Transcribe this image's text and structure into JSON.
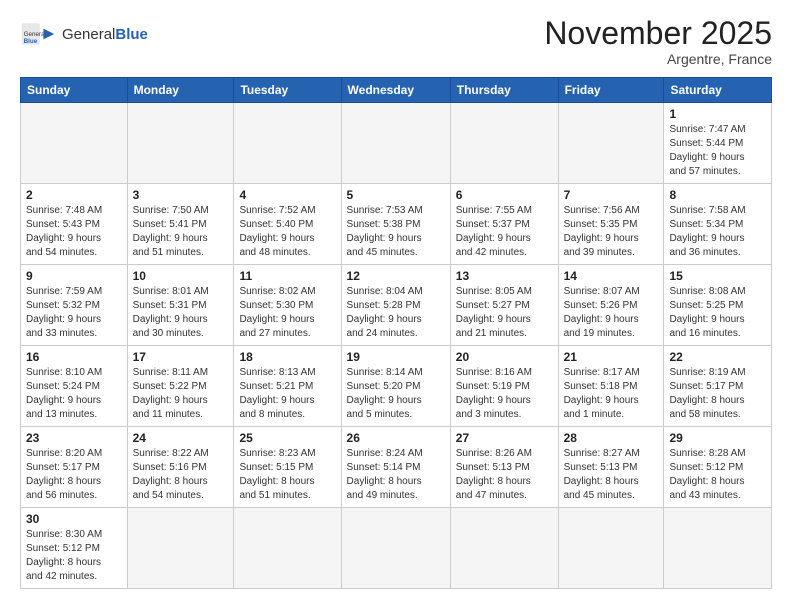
{
  "header": {
    "logo_general": "General",
    "logo_blue": "Blue",
    "month_title": "November 2025",
    "location": "Argentre, France"
  },
  "days_of_week": [
    "Sunday",
    "Monday",
    "Tuesday",
    "Wednesday",
    "Thursday",
    "Friday",
    "Saturday"
  ],
  "weeks": [
    [
      {
        "day": "",
        "info": ""
      },
      {
        "day": "",
        "info": ""
      },
      {
        "day": "",
        "info": ""
      },
      {
        "day": "",
        "info": ""
      },
      {
        "day": "",
        "info": ""
      },
      {
        "day": "",
        "info": ""
      },
      {
        "day": "1",
        "info": "Sunrise: 7:47 AM\nSunset: 5:44 PM\nDaylight: 9 hours\nand 57 minutes."
      }
    ],
    [
      {
        "day": "2",
        "info": "Sunrise: 7:48 AM\nSunset: 5:43 PM\nDaylight: 9 hours\nand 54 minutes."
      },
      {
        "day": "3",
        "info": "Sunrise: 7:50 AM\nSunset: 5:41 PM\nDaylight: 9 hours\nand 51 minutes."
      },
      {
        "day": "4",
        "info": "Sunrise: 7:52 AM\nSunset: 5:40 PM\nDaylight: 9 hours\nand 48 minutes."
      },
      {
        "day": "5",
        "info": "Sunrise: 7:53 AM\nSunset: 5:38 PM\nDaylight: 9 hours\nand 45 minutes."
      },
      {
        "day": "6",
        "info": "Sunrise: 7:55 AM\nSunset: 5:37 PM\nDaylight: 9 hours\nand 42 minutes."
      },
      {
        "day": "7",
        "info": "Sunrise: 7:56 AM\nSunset: 5:35 PM\nDaylight: 9 hours\nand 39 minutes."
      },
      {
        "day": "8",
        "info": "Sunrise: 7:58 AM\nSunset: 5:34 PM\nDaylight: 9 hours\nand 36 minutes."
      }
    ],
    [
      {
        "day": "9",
        "info": "Sunrise: 7:59 AM\nSunset: 5:32 PM\nDaylight: 9 hours\nand 33 minutes."
      },
      {
        "day": "10",
        "info": "Sunrise: 8:01 AM\nSunset: 5:31 PM\nDaylight: 9 hours\nand 30 minutes."
      },
      {
        "day": "11",
        "info": "Sunrise: 8:02 AM\nSunset: 5:30 PM\nDaylight: 9 hours\nand 27 minutes."
      },
      {
        "day": "12",
        "info": "Sunrise: 8:04 AM\nSunset: 5:28 PM\nDaylight: 9 hours\nand 24 minutes."
      },
      {
        "day": "13",
        "info": "Sunrise: 8:05 AM\nSunset: 5:27 PM\nDaylight: 9 hours\nand 21 minutes."
      },
      {
        "day": "14",
        "info": "Sunrise: 8:07 AM\nSunset: 5:26 PM\nDaylight: 9 hours\nand 19 minutes."
      },
      {
        "day": "15",
        "info": "Sunrise: 8:08 AM\nSunset: 5:25 PM\nDaylight: 9 hours\nand 16 minutes."
      }
    ],
    [
      {
        "day": "16",
        "info": "Sunrise: 8:10 AM\nSunset: 5:24 PM\nDaylight: 9 hours\nand 13 minutes."
      },
      {
        "day": "17",
        "info": "Sunrise: 8:11 AM\nSunset: 5:22 PM\nDaylight: 9 hours\nand 11 minutes."
      },
      {
        "day": "18",
        "info": "Sunrise: 8:13 AM\nSunset: 5:21 PM\nDaylight: 9 hours\nand 8 minutes."
      },
      {
        "day": "19",
        "info": "Sunrise: 8:14 AM\nSunset: 5:20 PM\nDaylight: 9 hours\nand 5 minutes."
      },
      {
        "day": "20",
        "info": "Sunrise: 8:16 AM\nSunset: 5:19 PM\nDaylight: 9 hours\nand 3 minutes."
      },
      {
        "day": "21",
        "info": "Sunrise: 8:17 AM\nSunset: 5:18 PM\nDaylight: 9 hours\nand 1 minute."
      },
      {
        "day": "22",
        "info": "Sunrise: 8:19 AM\nSunset: 5:17 PM\nDaylight: 8 hours\nand 58 minutes."
      }
    ],
    [
      {
        "day": "23",
        "info": "Sunrise: 8:20 AM\nSunset: 5:17 PM\nDaylight: 8 hours\nand 56 minutes."
      },
      {
        "day": "24",
        "info": "Sunrise: 8:22 AM\nSunset: 5:16 PM\nDaylight: 8 hours\nand 54 minutes."
      },
      {
        "day": "25",
        "info": "Sunrise: 8:23 AM\nSunset: 5:15 PM\nDaylight: 8 hours\nand 51 minutes."
      },
      {
        "day": "26",
        "info": "Sunrise: 8:24 AM\nSunset: 5:14 PM\nDaylight: 8 hours\nand 49 minutes."
      },
      {
        "day": "27",
        "info": "Sunrise: 8:26 AM\nSunset: 5:13 PM\nDaylight: 8 hours\nand 47 minutes."
      },
      {
        "day": "28",
        "info": "Sunrise: 8:27 AM\nSunset: 5:13 PM\nDaylight: 8 hours\nand 45 minutes."
      },
      {
        "day": "29",
        "info": "Sunrise: 8:28 AM\nSunset: 5:12 PM\nDaylight: 8 hours\nand 43 minutes."
      }
    ],
    [
      {
        "day": "30",
        "info": "Sunrise: 8:30 AM\nSunset: 5:12 PM\nDaylight: 8 hours\nand 42 minutes."
      },
      {
        "day": "",
        "info": ""
      },
      {
        "day": "",
        "info": ""
      },
      {
        "day": "",
        "info": ""
      },
      {
        "day": "",
        "info": ""
      },
      {
        "day": "",
        "info": ""
      },
      {
        "day": "",
        "info": ""
      }
    ]
  ]
}
